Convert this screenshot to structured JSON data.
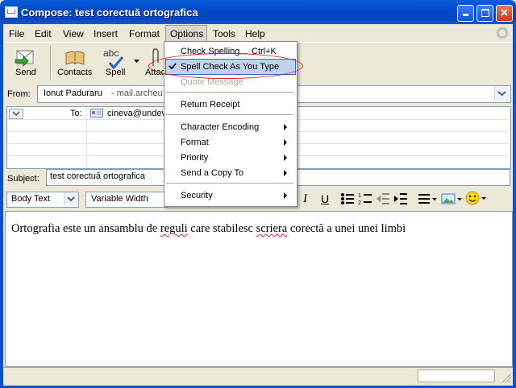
{
  "window": {
    "title": "Compose: test corectuă ortografica",
    "controls": {
      "minimize": "_",
      "maximize": "□",
      "close": "✕"
    }
  },
  "menubar": {
    "items": [
      {
        "label": "File"
      },
      {
        "label": "Edit"
      },
      {
        "label": "View"
      },
      {
        "label": "Insert"
      },
      {
        "label": "Format"
      },
      {
        "label": "Options"
      },
      {
        "label": "Tools"
      },
      {
        "label": "Help"
      }
    ],
    "open_menu": "Options"
  },
  "toolbar": {
    "send": "Send",
    "contacts": "Contacts",
    "spell": "Spell",
    "attach": "Attac",
    "spell_icon_text": "abc"
  },
  "header": {
    "from_label": "From:",
    "from_name": "Ionut Paduraru",
    "from_email": "- mail.archeu",
    "to_label": "To:",
    "to_value": "cineva@undev",
    "subject_label": "Subject:",
    "subject_value": "test corectuă ortografica"
  },
  "format_bar": {
    "paragraph_style": "Body Text",
    "font": "Variable Width",
    "italic": "I",
    "underline": "U"
  },
  "body": {
    "segments": [
      {
        "text": "Ortografia este un ansamblu de ",
        "misspelled": false
      },
      {
        "text": "reguli",
        "misspelled": true
      },
      {
        "text": " care stabilesc ",
        "misspelled": false
      },
      {
        "text": "scriera",
        "misspelled": true
      },
      {
        "text": " corectă a unei unei limbi",
        "misspelled": false
      }
    ]
  },
  "options_menu": {
    "check_spelling": "Check Spelling...",
    "check_spelling_shortcut": "Ctrl+K",
    "spell_check_as_you_type": "Spell Check As You Type",
    "spell_check_as_you_type_checked": true,
    "quote_message": "Quote Message",
    "return_receipt": "Return Receipt",
    "character_encoding": "Character Encoding",
    "format": "Format",
    "priority": "Priority",
    "send_copy_to": "Send a Copy To",
    "security": "Security"
  },
  "colors": {
    "titlebar": "#0a5fd8",
    "highlight": "#c1d2ee",
    "annotation_ellipse": "#e02020",
    "disabled_text": "#aca899"
  }
}
